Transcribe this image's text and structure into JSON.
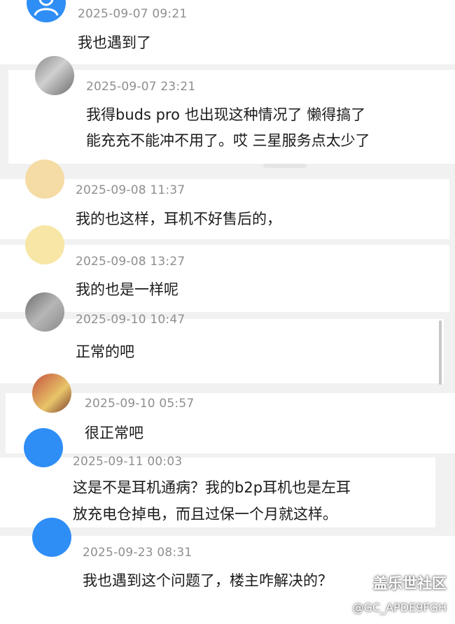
{
  "comments": [
    {
      "time": "2025-09-07 09:21",
      "lines": [
        "我也遇到了"
      ]
    },
    {
      "time": "2025-09-07 23:21",
      "lines": [
        "我得buds pro 也出现这种情况了  懒得搞了",
        "能充充不能冲不用了。哎 三星服务点太少了"
      ]
    },
    {
      "time": "2025-09-08 11:37",
      "lines": [
        "我的也这样，耳机不好售后的，"
      ]
    },
    {
      "time": "2025-09-08 13:27",
      "lines": [
        "我的也是一样呢"
      ]
    },
    {
      "time": "2025-09-10 10:47",
      "lines": [
        "正常的吧"
      ]
    },
    {
      "time": "2025-09-10 05:57",
      "lines": [
        "很正常吧"
      ]
    },
    {
      "time": "2025-09-11 00:03",
      "lines": [
        "这是不是耳机通病？我的b2p耳机也是左耳",
        "放充电仓掉电，而且过保一个月就这样。"
      ]
    },
    {
      "time": "2025-09-23 08:31",
      "lines": [
        "我也遇到这个问题了，楼主咋解决的？"
      ]
    }
  ],
  "watermark": {
    "title": "盖乐世社区",
    "user": "@GC_APDE9FGH"
  },
  "colors": {
    "avatar_blue": "#2f8ef5",
    "background": "#f1f1f1",
    "card": "#ffffff"
  }
}
